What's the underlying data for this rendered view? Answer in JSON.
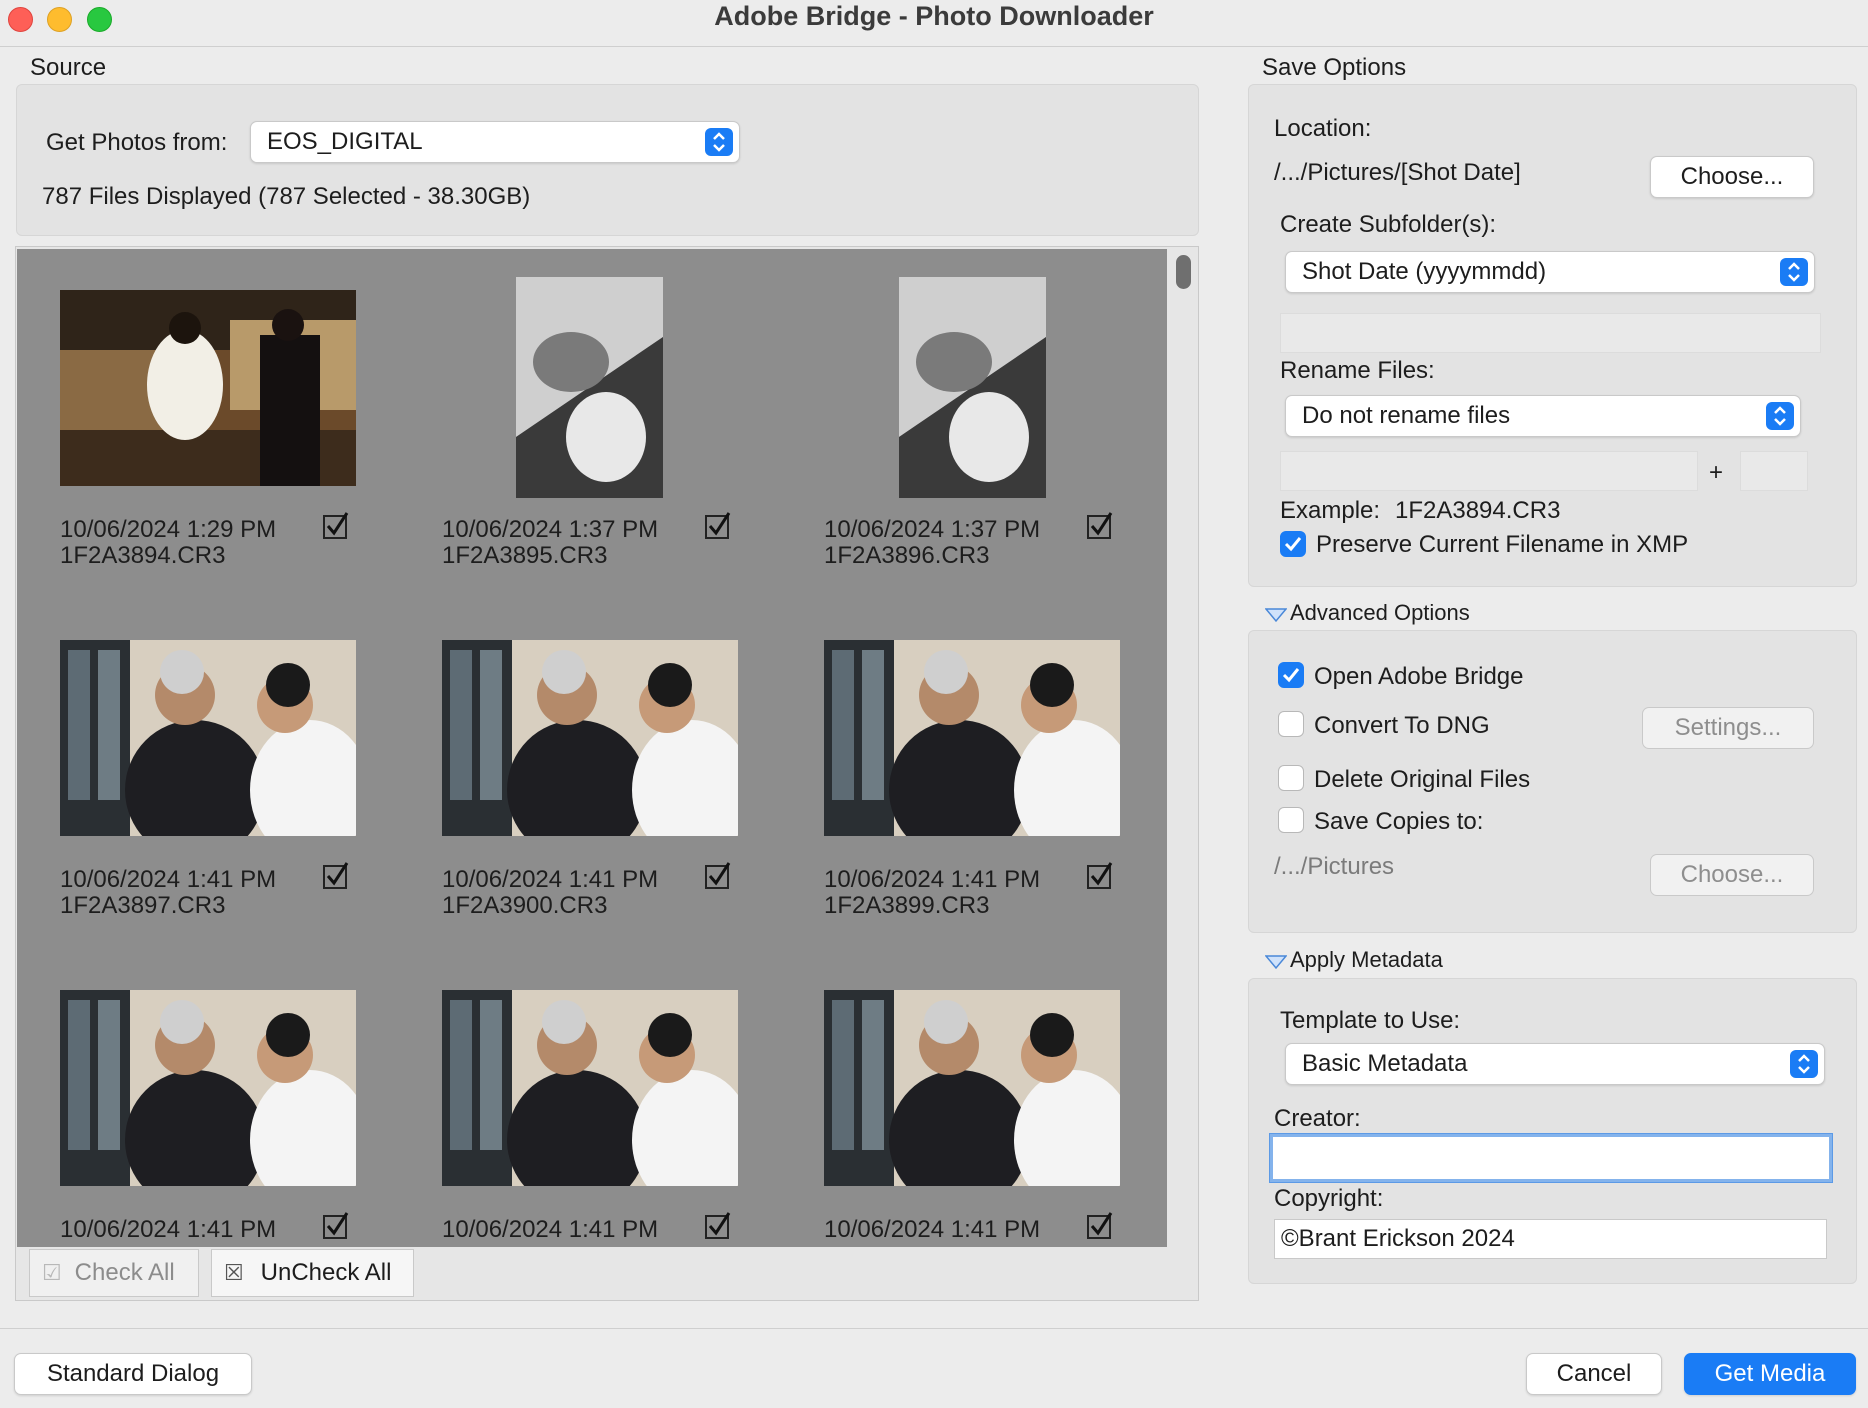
{
  "window": {
    "title": "Adobe Bridge - Photo Downloader"
  },
  "source": {
    "section_label": "Source",
    "get_from_label": "Get Photos from:",
    "get_from_value": "EOS_DIGITAL",
    "files_status": "787 Files Displayed (787 Selected - 38.30GB)"
  },
  "thumbnails": [
    {
      "date": "10/06/2024 1:29 PM",
      "filename": "1F2A3894.CR3",
      "checked": true,
      "image": "event-setup-photo"
    },
    {
      "date": "10/06/2024 1:37 PM",
      "filename": "1F2A3895.CR3",
      "checked": true,
      "image": "bw-portrait-photo"
    },
    {
      "date": "10/06/2024 1:37 PM",
      "filename": "1F2A3896.CR3",
      "checked": true,
      "image": "bw-portrait-photo"
    },
    {
      "date": "10/06/2024 1:41 PM",
      "filename": "1F2A3897.CR3",
      "checked": true,
      "image": "tie-adjust-photo"
    },
    {
      "date": "10/06/2024 1:41 PM",
      "filename": "1F2A3900.CR3",
      "checked": true,
      "image": "tie-adjust-photo"
    },
    {
      "date": "10/06/2024 1:41 PM",
      "filename": "1F2A3899.CR3",
      "checked": true,
      "image": "tie-adjust-photo"
    },
    {
      "date": "10/06/2024 1:41 PM",
      "filename": "",
      "checked": true,
      "image": "tie-adjust-photo"
    },
    {
      "date": "10/06/2024 1:41 PM",
      "filename": "",
      "checked": true,
      "image": "tie-adjust-photo"
    },
    {
      "date": "10/06/2024 1:41 PM",
      "filename": "",
      "checked": true,
      "image": "tie-adjust-photo"
    }
  ],
  "grid_buttons": {
    "check_all": "Check All",
    "uncheck_all": "UnCheck All"
  },
  "save_options": {
    "section_label": "Save Options",
    "location_label": "Location:",
    "location_value": "/.../Pictures/[Shot Date]",
    "choose_label": "Choose...",
    "subfolder_label": "Create Subfolder(s):",
    "subfolder_value": "Shot Date (yyyymmdd)",
    "rename_label": "Rename Files:",
    "rename_value": "Do not rename files",
    "plus": "+",
    "example_label": "Example:",
    "example_value": "1F2A3894.CR3",
    "preserve_label": "Preserve Current Filename in XMP",
    "preserve_checked": true
  },
  "advanced_options": {
    "section_label": "Advanced Options",
    "open_bridge_label": "Open Adobe Bridge",
    "open_bridge_checked": true,
    "convert_dng_label": "Convert To DNG",
    "convert_dng_checked": false,
    "settings_label": "Settings...",
    "delete_originals_label": "Delete Original Files",
    "delete_originals_checked": false,
    "save_copies_label": "Save Copies to:",
    "save_copies_checked": false,
    "copies_path": "/.../Pictures",
    "copies_choose_label": "Choose..."
  },
  "metadata": {
    "section_label": "Apply Metadata",
    "template_label": "Template to Use:",
    "template_value": "Basic Metadata",
    "creator_label": "Creator:",
    "creator_value": "",
    "copyright_label": "Copyright:",
    "copyright_value": "©Brant Erickson 2024"
  },
  "footer": {
    "standard_dialog": "Standard Dialog",
    "cancel": "Cancel",
    "get_media": "Get Media"
  },
  "colors": {
    "accent": "#1a7cf5",
    "grid_bg": "#8d8d8d"
  }
}
